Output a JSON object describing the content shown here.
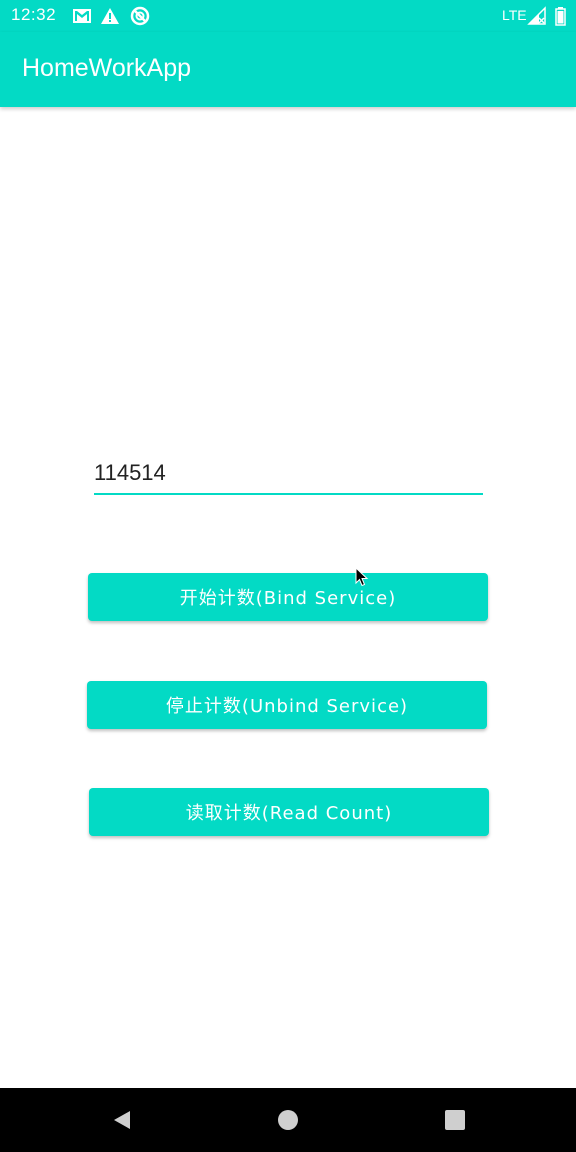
{
  "status_bar": {
    "time": "12:32",
    "network": "LTE",
    "icons": [
      "gmail-icon",
      "warning-icon",
      "sync-off-icon",
      "signal-icon",
      "battery-icon"
    ]
  },
  "app_bar": {
    "title": "HomeWorkApp"
  },
  "main": {
    "count_value": "114514",
    "buttons": {
      "bind": "开始计数(Bind Service)",
      "unbind": "停止计数(Unbind Service)",
      "read": "读取计数(Read Count)"
    }
  },
  "nav_bar": {
    "icons": [
      "back-icon",
      "home-icon",
      "recents-icon"
    ]
  },
  "colors": {
    "accent": "#03DAC5",
    "nav_background": "#000000",
    "text_on_accent": "#ffffff"
  }
}
